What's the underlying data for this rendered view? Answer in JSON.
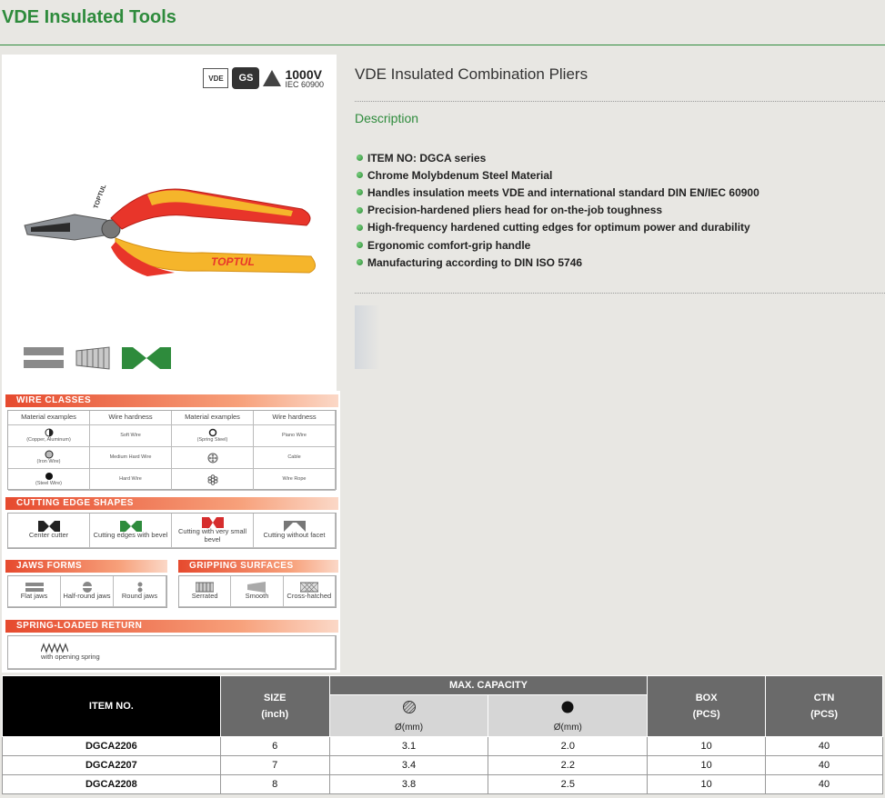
{
  "page": {
    "title": "VDE Insulated Tools"
  },
  "product": {
    "name": "VDE Insulated Combination Pliers",
    "description_label": "Description",
    "features": [
      "ITEM NO: DGCA series",
      "Chrome Molybdenum Steel Material",
      "Handles insulation meets VDE and international standard DIN EN/IEC 60900",
      "Precision-hardened pliers head for on-the-job toughness",
      "High-frequency hardened cutting edges for optimum power and durability",
      "Ergonomic comfort-grip handle",
      "Manufacturing according to DIN ISO 5746"
    ],
    "certs": {
      "vde": "VDE",
      "gs": "GS",
      "voltage": "1000V",
      "standard": "IEC 60900"
    },
    "brand_text": "TOPTUL",
    "colors": {
      "accent_green": "#2e8b3c",
      "handle_red": "#e8352a",
      "handle_yellow": "#f5b52b"
    }
  },
  "reference": {
    "wire_classes": {
      "header": "WIRE CLASSES",
      "columns": [
        "Material examples",
        "Wire hardness",
        "Material examples",
        "Wire hardness"
      ],
      "rows": [
        [
          "(Copper, Aluminum)",
          "Soft Wire",
          "(Spring Steel)",
          "Piano Wire"
        ],
        [
          "(Iron Wire)",
          "Medium Hard Wire",
          "",
          "Cable"
        ],
        [
          "(Steel Wire)",
          "Hard Wire",
          "",
          "Wire Rope"
        ]
      ]
    },
    "cutting_edge": {
      "header": "CUTTING EDGE SHAPES",
      "items": [
        "Center cutter",
        "Cutting edges with bevel",
        "Cutting with very small bevel",
        "Cutting without facet"
      ]
    },
    "jaws": {
      "header": "JAWS FORMS",
      "items": [
        "Flat jaws",
        "Half-round jaws",
        "Round jaws"
      ]
    },
    "gripping": {
      "header": "GRIPPING SURFACES",
      "items": [
        "Serrated",
        "Smooth",
        "Cross-hatched"
      ]
    },
    "spring": {
      "header": "SPRING-LOADED RETURN",
      "label": "with opening spring"
    }
  },
  "spec_table": {
    "headers": {
      "item": "ITEM NO.",
      "size": "SIZE",
      "size_unit": "(inch)",
      "capacity": "MAX. CAPACITY",
      "cap_unit_1": "Ø(mm)",
      "cap_unit_2": "Ø(mm)",
      "box": "BOX",
      "box_unit": "(PCS)",
      "ctn": "CTN",
      "ctn_unit": "(PCS)"
    },
    "rows": [
      {
        "item": "DGCA2206",
        "size": "6",
        "cap1": "3.1",
        "cap2": "2.0",
        "box": "10",
        "ctn": "40"
      },
      {
        "item": "DGCA2207",
        "size": "7",
        "cap1": "3.4",
        "cap2": "2.2",
        "box": "10",
        "ctn": "40"
      },
      {
        "item": "DGCA2208",
        "size": "8",
        "cap1": "3.8",
        "cap2": "2.5",
        "box": "10",
        "ctn": "40"
      }
    ]
  }
}
